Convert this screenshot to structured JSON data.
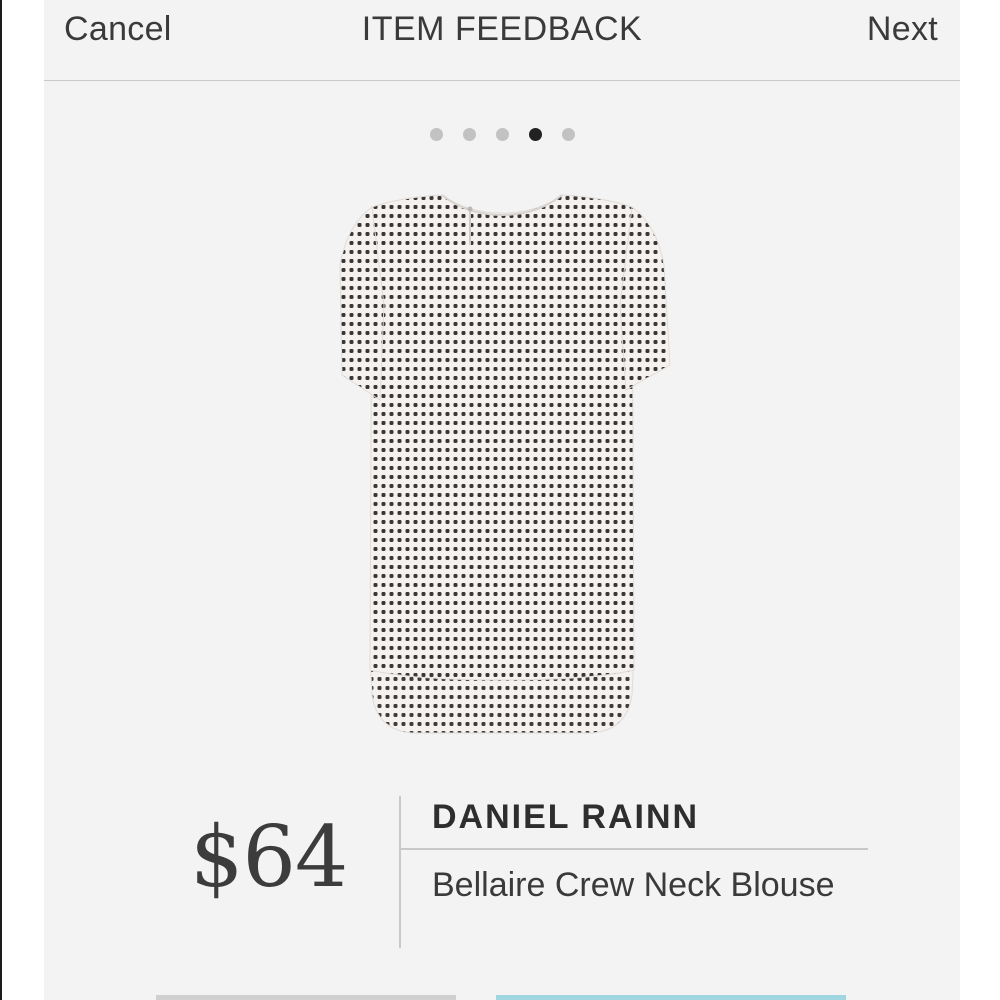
{
  "header": {
    "cancel_label": "Cancel",
    "title": "ITEM FEEDBACK",
    "next_label": "Next"
  },
  "pagination": {
    "total": 5,
    "current": 4
  },
  "product": {
    "price": "$64",
    "brand": "DANIEL RAINN",
    "name": "Bellaire Crew Neck Blouse",
    "image_description_icon": "polka-dot-blouse-image"
  },
  "colors": {
    "background": "#f3f3f3",
    "text": "#3a3a3a",
    "active_dot": "#222222",
    "inactive_dot": "#c2c2c2",
    "accent": "#9fd6e0"
  }
}
